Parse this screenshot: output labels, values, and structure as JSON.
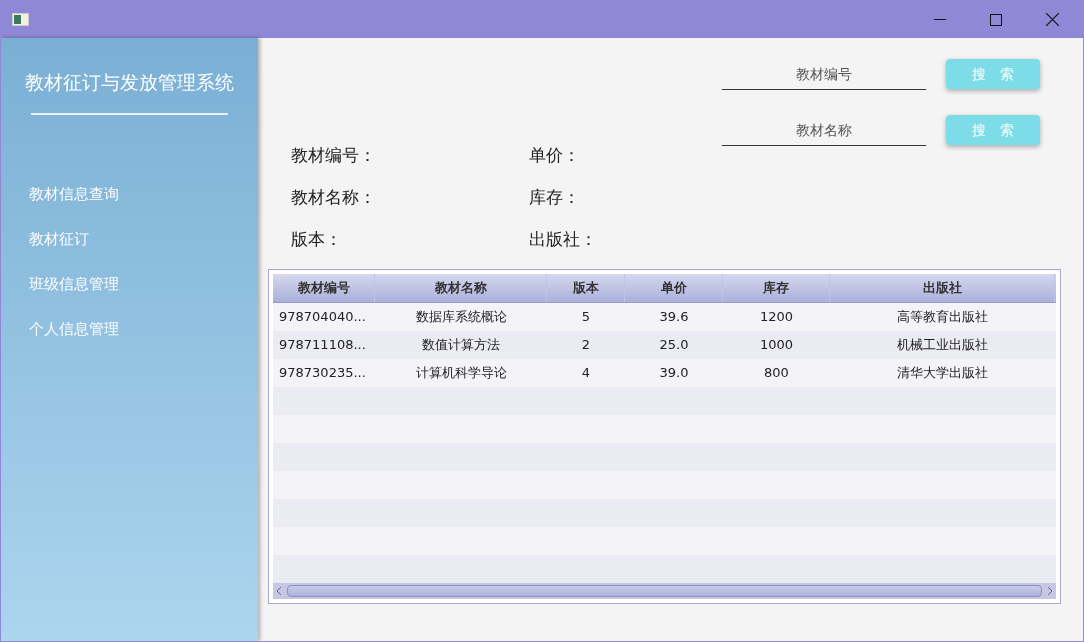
{
  "sidebar": {
    "title": "教材征订与发放管理系统",
    "items": [
      {
        "label": "教材信息查询"
      },
      {
        "label": "教材征订"
      },
      {
        "label": "班级信息管理"
      },
      {
        "label": "个人信息管理"
      }
    ]
  },
  "searches": [
    {
      "placeholder": "教材编号",
      "button": "搜　索"
    },
    {
      "placeholder": "教材名称",
      "button": "搜　索"
    }
  ],
  "details": [
    {
      "label": "教材编号："
    },
    {
      "label": "单价："
    },
    {
      "label": "教材名称："
    },
    {
      "label": "库存："
    },
    {
      "label": "版本："
    },
    {
      "label": "出版社："
    }
  ],
  "table": {
    "columns": [
      "教材编号",
      "教材名称",
      "版本",
      "单价",
      "库存",
      "出版社"
    ],
    "rows": [
      [
        "978704040...",
        "数据库系统概论",
        "5",
        "39.6",
        "1200",
        "高等教育出版社"
      ],
      [
        "978711108...",
        "数值计算方法",
        "2",
        "25.0",
        "1000",
        "机械工业出版社"
      ],
      [
        "978730235...",
        "计算机科学导论",
        "4",
        "39.0",
        "800",
        "清华大学出版社"
      ]
    ]
  }
}
